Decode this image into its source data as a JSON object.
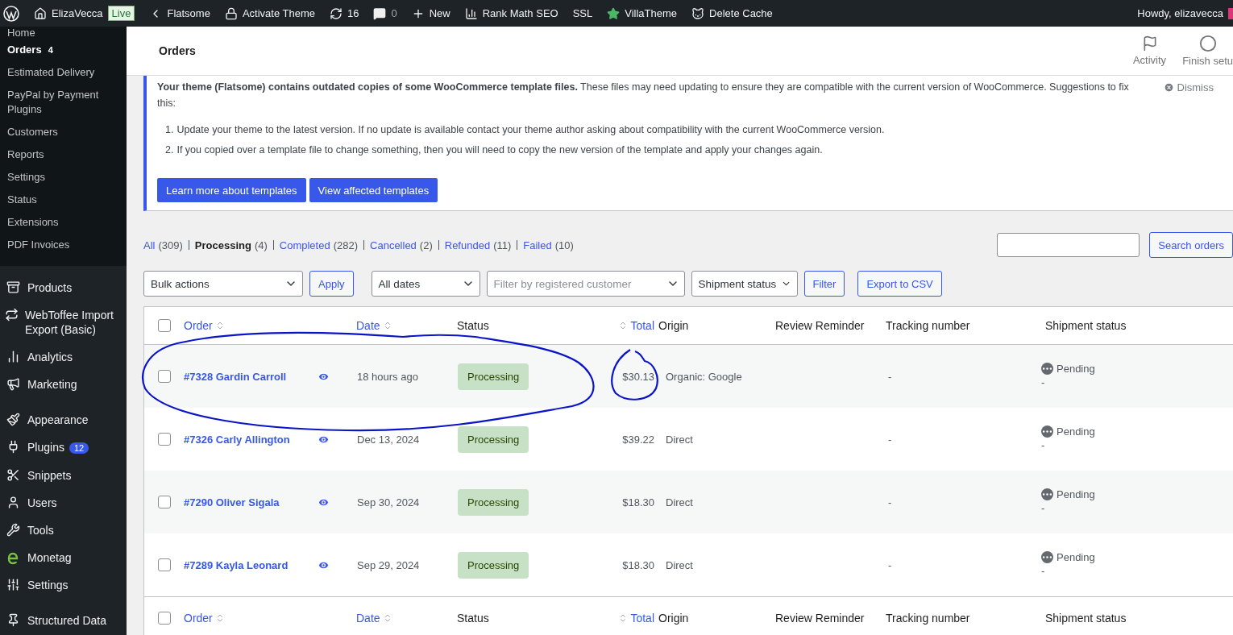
{
  "admin_bar": {
    "site": "ElizaVecca",
    "live_badge": "Live",
    "items": [
      {
        "label": "Flatsome"
      },
      {
        "label": "Activate Theme"
      },
      {
        "label": "16"
      },
      {
        "label": "0"
      },
      {
        "label": "New"
      },
      {
        "label": "Rank Math SEO"
      },
      {
        "label": "SSL"
      },
      {
        "label": "VillaTheme"
      },
      {
        "label": "Delete Cache"
      }
    ],
    "greeting": "Howdy, elizavecca"
  },
  "sidebar": {
    "submenu": [
      {
        "label": "Home",
        "selected": false
      },
      {
        "label": "Orders",
        "count": "4",
        "selected": true
      },
      {
        "label": "Estimated Delivery",
        "selected": false
      },
      {
        "label": "PayPal by Payment Plugins",
        "selected": false
      },
      {
        "label": "Customers",
        "selected": false
      },
      {
        "label": "Reports",
        "selected": false
      },
      {
        "label": "Settings",
        "selected": false
      },
      {
        "label": "Status",
        "selected": false
      },
      {
        "label": "Extensions",
        "selected": false
      },
      {
        "label": "PDF Invoices",
        "selected": false
      }
    ],
    "menu_groups": [
      [
        {
          "label": "Products"
        },
        {
          "label": "WebToffee Import Export (Basic)"
        },
        {
          "label": "Analytics"
        },
        {
          "label": "Marketing"
        }
      ],
      [
        {
          "label": "Appearance"
        },
        {
          "label": "Plugins",
          "badge": "12"
        },
        {
          "label": "Snippets"
        },
        {
          "label": "Users"
        },
        {
          "label": "Tools"
        },
        {
          "label": "Monetag"
        },
        {
          "label": "Settings"
        }
      ],
      [
        {
          "label": "Structured Data"
        }
      ]
    ]
  },
  "header": {
    "title": "Orders",
    "actions": [
      {
        "label": "Activity"
      },
      {
        "label": "Finish setu"
      }
    ]
  },
  "notice": {
    "text": "**Your theme (Flatsome) contains outdated copies of some WooCommerce template files.** These files may need updating to ensure they are compatible with the current version of WooCommerce. Suggestions to fix this:",
    "dismiss": "Dismiss",
    "steps": [
      {
        "number": "1.",
        "text": "Update your theme to the latest version. If no update is available contact your theme author asking about compatibility with the current WooCommerce version."
      },
      {
        "number": "2.",
        "text": "If you copied over a template file to change something, then you will need to copy the new version of the template and apply your changes again."
      }
    ],
    "buttons": [
      "Learn more about templates",
      "View affected templates"
    ]
  },
  "status_filters": [
    {
      "label": "All",
      "count": "(309)",
      "selected": false
    },
    {
      "label": "Processing",
      "count": "(4)",
      "selected": true
    },
    {
      "label": "Completed",
      "count": "(282)",
      "selected": false
    },
    {
      "label": "Cancelled",
      "count": "(2)",
      "selected": false
    },
    {
      "label": "Refunded",
      "count": "(11)",
      "selected": false
    },
    {
      "label": "Failed",
      "count": "(10)",
      "selected": false
    }
  ],
  "search_button": "Search orders",
  "toolbar": {
    "bulk_actions": "Bulk actions",
    "apply": "Apply",
    "dates": "All dates",
    "customer_placeholder": "Filter by registered customer",
    "shipment": "Shipment status",
    "filter": "Filter",
    "export": "Export to CSV"
  },
  "table": {
    "select_all_checked": false,
    "header_columns": [
      {
        "label": "Order",
        "sortable": true
      },
      {
        "label": "Date",
        "sortable": true
      },
      {
        "label": "Status",
        "sortable": false
      },
      {
        "label": "Total",
        "sortable": true
      },
      {
        "label": "Origin",
        "sortable": false
      },
      {
        "label": "Review Reminder",
        "sortable": false
      },
      {
        "label": "Tracking number",
        "sortable": false
      },
      {
        "label": "Shipment status",
        "sortable": false
      }
    ],
    "rows": [
      {
        "checked": false,
        "order": "#7328 Gardin Carroll",
        "date": "18 hours ago",
        "status": "Processing",
        "total": "$30.13",
        "origin": "Organic: Google",
        "tracking": "-",
        "shipment": "Pending",
        "shipment_note": "-"
      },
      {
        "checked": false,
        "order": "#7326 Carly Allington",
        "date": "Dec 13, 2024",
        "status": "Processing",
        "total": "$39.22",
        "origin": "Direct",
        "tracking": "-",
        "shipment": "Pending",
        "shipment_note": "-"
      },
      {
        "checked": false,
        "order": "#7290 Oliver Sigala",
        "date": "Sep 30, 2024",
        "status": "Processing",
        "total": "$18.30",
        "origin": "Direct",
        "tracking": "-",
        "shipment": "Pending",
        "shipment_note": "-"
      },
      {
        "checked": false,
        "order": "#7289 Kayla Leonard",
        "date": "Sep 29, 2024",
        "status": "Processing",
        "total": "$18.30",
        "origin": "Direct",
        "tracking": "-",
        "shipment": "Pending",
        "shipment_note": "-"
      }
    ],
    "footer_select_all_checked": false,
    "footer_columns": [
      {
        "label": "Order",
        "sortable": true
      },
      {
        "label": "Date",
        "sortable": true
      },
      {
        "label": "Status",
        "sortable": false
      },
      {
        "label": "Total",
        "sortable": true
      },
      {
        "label": "Origin",
        "sortable": false
      },
      {
        "label": "Review Reminder",
        "sortable": false
      },
      {
        "label": "Tracking number",
        "sortable": false
      },
      {
        "label": "Shipment status",
        "sortable": false
      }
    ]
  }
}
